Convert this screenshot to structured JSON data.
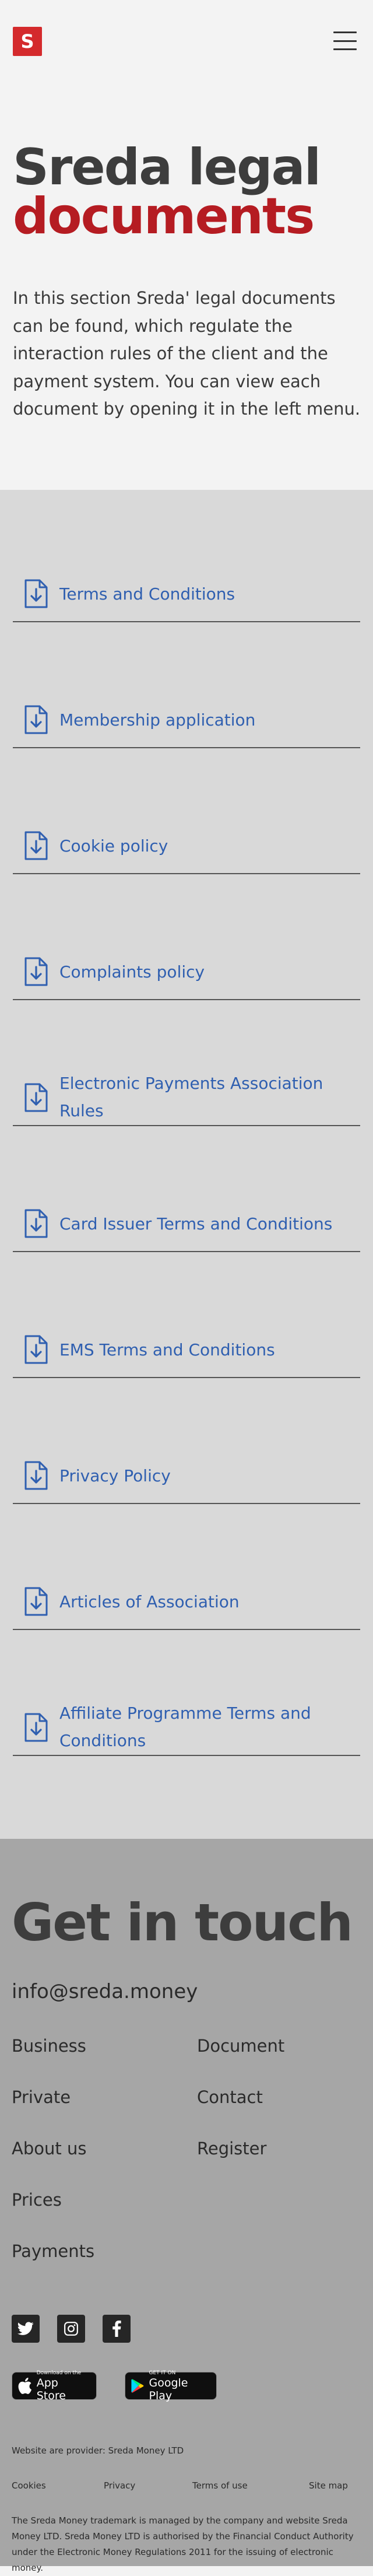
{
  "header": {
    "logo_letter": "S",
    "title_line1": "Sreda legal",
    "title_line2": "documents",
    "intro": "In this section Sreda' legal documents can be found, which regulate the interaction rules of the client and the payment system. You can view each document by opening it in the left menu.",
    "colors": {
      "brand_red": "#d42a2c",
      "title_red": "#b51c22",
      "link_blue": "#2f5fb0"
    }
  },
  "documents": [
    {
      "label": "Terms and Conditions",
      "icon": "document-download-icon"
    },
    {
      "label": "Membership application",
      "icon": "document-download-icon"
    },
    {
      "label": "Cookie policy",
      "icon": "document-download-icon"
    },
    {
      "label": "Complaints policy",
      "icon": "document-download-icon"
    },
    {
      "label": "Electronic Payments Association Rules",
      "icon": "document-download-icon"
    },
    {
      "label": "Card Issuer Terms and Conditions",
      "icon": "document-download-icon"
    },
    {
      "label": "EMS Terms and Conditions",
      "icon": "document-download-icon"
    },
    {
      "label": "Privacy Policy",
      "icon": "document-download-icon"
    },
    {
      "label": "Articles of Association",
      "icon": "document-download-icon"
    },
    {
      "label": "Affiliate Programme Terms and Conditions",
      "icon": "document-download-icon"
    }
  ],
  "footer": {
    "title": "Get in touch",
    "email": "info@sreda.money",
    "links": [
      "Business",
      "Document",
      "Private",
      "Contact",
      "About us",
      "Register",
      "Prices",
      "Payments"
    ],
    "socials": [
      "twitter-icon",
      "instagram-icon",
      "facebook-icon"
    ],
    "app_store": {
      "small": "Download on the",
      "big": "App Store"
    },
    "google_play": {
      "small": "GET IT ON",
      "big": "Google Play"
    },
    "provider": "Website are provider: Sreda Money LTD",
    "legal_links": [
      "Cookies",
      "Privacy",
      "Terms of use",
      "Site map"
    ],
    "fine_print": "The Sreda Money trademark is managed by the company  and website Sreda Money LTD. Sreda Money LTD is authorised by the Financial Conduct Authority under the Electronic Money Regulations 2011 for the issuing of electronic money."
  }
}
